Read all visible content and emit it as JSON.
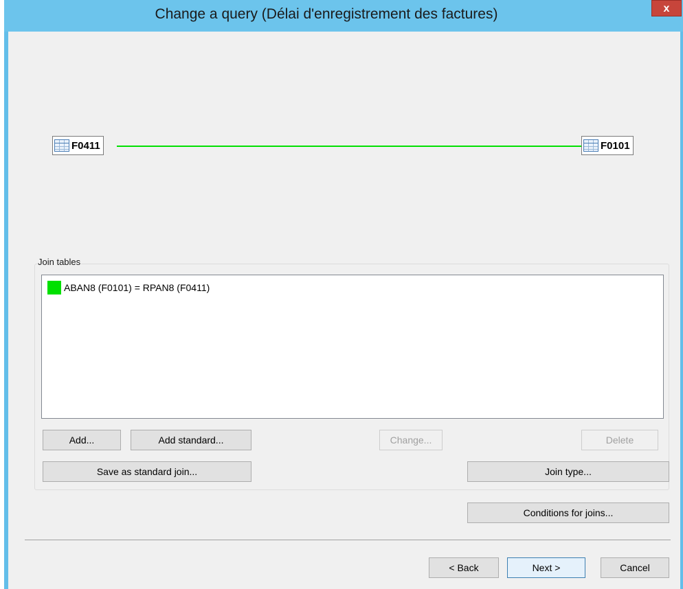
{
  "window": {
    "title": "Change a query (Délai d'enregistrement des factures)",
    "close_label": "x"
  },
  "diagram": {
    "left_table": "F0411",
    "right_table": "F0101",
    "join_line_color": "#00e000"
  },
  "join_tables": {
    "group_label": "Join tables",
    "items": [
      {
        "text": "ABAN8 (F0101) = RPAN8 (F0411)",
        "color": "#00e000"
      }
    ]
  },
  "buttons": {
    "add": "Add...",
    "add_standard": "Add standard...",
    "change": "Change...",
    "delete": "Delete",
    "save_standard": "Save as standard join...",
    "join_type": "Join type...",
    "conditions": "Conditions for joins...",
    "back": "< Back",
    "next": "Next >",
    "cancel": "Cancel"
  }
}
